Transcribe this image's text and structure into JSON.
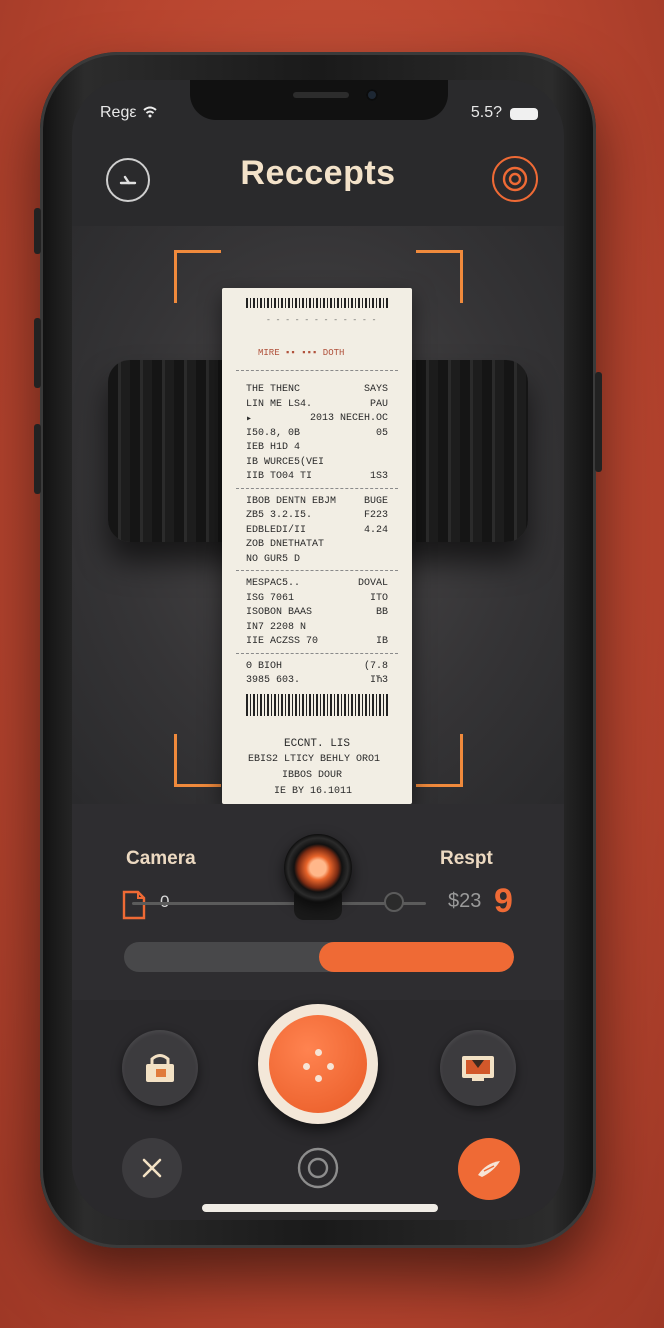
{
  "status_bar": {
    "carrier": "Regε",
    "signal_glyph": "ᴇ",
    "time": "5.5?"
  },
  "header": {
    "title": "Reccepts",
    "back_icon": "clock-back-icon",
    "settings_icon": "target-icon"
  },
  "receipt": {
    "lines": [
      {
        "left": "THE THENC",
        "right": "SAYS"
      },
      {
        "left": "LIN ME LS4.",
        "right": "PAU"
      },
      {
        "left": "▸",
        "right": "2013 NECEH.OC"
      },
      {
        "left": "I50.8, 0B",
        "right": "05"
      },
      {
        "left": "IEB H1D 4"
      },
      {
        "left": "IB WURCE5(VEI"
      },
      {
        "left": "IIB TO04 TI",
        "right": "1S3"
      },
      {
        "left": "IBOB DENTN  EBJM",
        "right": "BUGE"
      },
      {
        "left": "ZB5 3.2.I5.",
        "right": "F223"
      },
      {
        "left": "EDBLEDI/II",
        "right": "4.24"
      },
      {
        "left": "ZOB DNETHATAT"
      },
      {
        "left": "NO GUR5  D"
      },
      {
        "left": "MESPAC5..",
        "right": "DOVAL"
      },
      {
        "left": "ISG 7061",
        "right": "ITO"
      },
      {
        "left": "ISOBON BAAS",
        "right": "BB"
      },
      {
        "left": "IN7 2208 N"
      },
      {
        "left": "IIE ACZSS 70",
        "right": "IB"
      },
      {
        "left": "Θ      BIOH",
        "right": "(7.8"
      },
      {
        "left": "3985    603.",
        "right": "IЋ3"
      }
    ],
    "footer": [
      "ECCNT. LIS",
      "EBIS2  LTICY BEHLY  ORO1",
      "IBBOS  DOUR",
      "IE BY 16.1011"
    ]
  },
  "controls": {
    "left_label": "Camera",
    "right_label": "Respt",
    "slider_value": "0",
    "amount": "$23",
    "amount_count": "9",
    "progress": 0.5,
    "accent": "#ef6a35"
  },
  "bottom_bar": {
    "left_button_icon": "lock-icon",
    "shutter_icon": "shutter-icon",
    "right_button_icon": "monitor-icon",
    "close_icon": "close-icon",
    "center_icon": "target-icon",
    "confirm_icon": "brush-icon"
  }
}
